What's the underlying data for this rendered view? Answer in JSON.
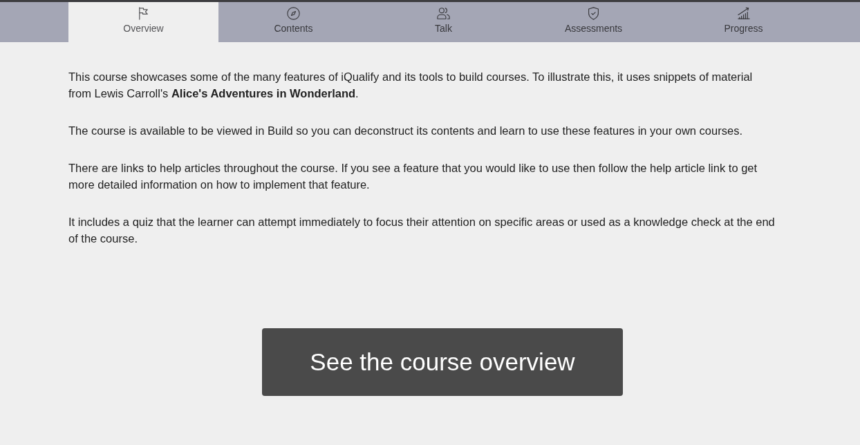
{
  "tabs": [
    {
      "label": "Overview",
      "selected": true
    },
    {
      "label": "Contents",
      "selected": false
    },
    {
      "label": "Talk",
      "selected": false
    },
    {
      "label": "Assessments",
      "selected": false
    },
    {
      "label": "Progress",
      "selected": false
    }
  ],
  "paragraphs": [
    "This course showcases some of the many features of iQualify and its tools to build courses. To illustrate this, it uses snippets of material from Lewis Carroll's **Alice's Adventures in Wonderland**.",
    "The course is available to be viewed in Build so you can deconstruct its contents and learn to use these features in your own courses.",
    "There are links to help articles throughout the course. If you see a feature that you would like to use then follow the help article link to get more detailed information on how to implement that feature.",
    "It includes a quiz that the learner can attempt immediately to focus their attention on specific areas or used as a knowledge check at the end of the course."
  ],
  "cta_button": {
    "label": "See the course overview"
  }
}
